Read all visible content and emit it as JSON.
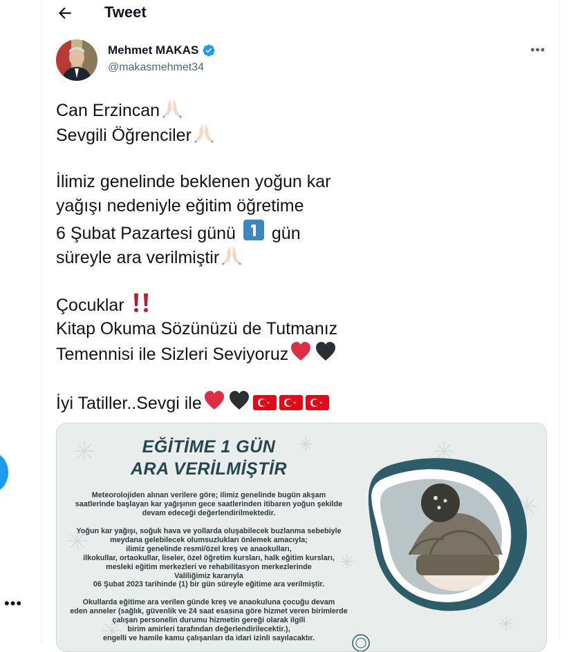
{
  "header": {
    "title": "Tweet"
  },
  "author": {
    "name": "Mehmet MAKAS",
    "handle": "@makasmehmet34"
  },
  "tweet": {
    "line1": "Can Erzincan",
    "line2": "Sevgili Öğrenciler",
    "line3": "İlimiz genelinde beklenen yoğun kar",
    "line4": "yağışı nedeniyle eğitim öğretime",
    "line5a": "6 Şubat Pazartesi günü",
    "line5b": "gün",
    "line6": "süreyle ara verilmiştir",
    "line7": "Çocuklar",
    "line8": "Kitap Okuma Sözünüzü de Tutmanız",
    "line9": "Temennisi ile Sizleri Seviyoruz",
    "line10": "İyi Tatiller..Sevgi ile"
  },
  "poster": {
    "title1": "EĞİTİME 1 GÜN",
    "title2": "ARA VERİLMİŞTİR",
    "p1": [
      "Meteorolojiden alınan verilere göre; ilimiz genelinde bugün akşam",
      "saatlerinde başlayan kar yağışının gece saatlerinden itibaren yoğun şekilde",
      "devam edeceği değerlendirilmektedir."
    ],
    "p2": [
      "Yoğun kar yağışı, soğuk hava ve yollarda oluşabilecek buzlanma sebebiyle",
      "meydana gelebilecek olumsuzlukları önlemek amacıyla;",
      "ilimiz genelinde resmi/özel kreş ve anaokulları,",
      "ilkokullar, ortaokullar, liseler, özel öğretim kursları, halk eğitim kursları,",
      "mesleki eğitim merkezleri ve rehabilitasyon merkezlerinde",
      "Valiliğimiz kararıyla",
      "06 Şubat 2023 tarihinde (1) bir gün süreyle eğitime ara verilmiştir."
    ],
    "p3": [
      "Okullarda eğitime ara verilen günde kreş ve anaokuluna çocuğu devam",
      "eden anneler (sağlık, güvenlik ve 24 saat esasına göre hizmet veren birimlerde",
      "çalışan personelin durumu hizmetin gereği olarak ilgili",
      "birim amirleri tarafından değerlendirilecektir.),",
      "engelli ve hamile kamu çalışanları da idari izinli sayılacaktır."
    ]
  },
  "colors": {
    "accent": "#1d9bf0",
    "text": "#0f1419",
    "secondary": "#536471",
    "poster_bg": "#e9eeed",
    "poster_title": "#24474e"
  },
  "icons": [
    "back-arrow-icon",
    "verified-badge-icon",
    "more-icon",
    "folded-hands-emoji",
    "keycap-1-emoji",
    "double-exclamation-emoji",
    "red-heart-emoji",
    "black-heart-emoji",
    "turkey-flag-emoji"
  ]
}
